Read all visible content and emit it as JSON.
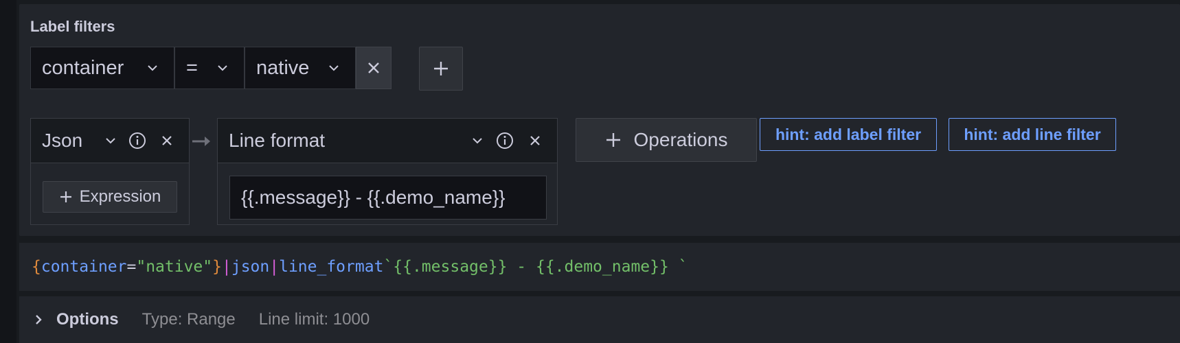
{
  "label_filters": {
    "title": "Label filters",
    "key": "container",
    "operator": "=",
    "value": "native"
  },
  "operations": [
    {
      "name": "Json",
      "add_expression_label": "Expression"
    },
    {
      "name": "Line format",
      "input_value": "{{.message}} - {{.demo_name}}"
    }
  ],
  "add_operations_label": "Operations",
  "hints": {
    "label_filter": "hint: add label filter",
    "line_filter": "hint: add line filter"
  },
  "query": {
    "open_brace": "{",
    "label": "container",
    "eq": "=",
    "value": "\"native\"",
    "close_brace": "}",
    "pipe1": "|",
    "json": "json",
    "pipe2": "|",
    "line_format_fn": "line_format",
    "template": "`{{.message}} - {{.demo_name}} `"
  },
  "options": {
    "title": "Options",
    "type": "Type: Range",
    "line_limit": "Line limit: 1000"
  },
  "colors": {
    "accent_blue": "#6e9fff",
    "string_green": "#73bf69",
    "brace_orange": "#e08a3c",
    "pipe_magenta": "#d75fd9"
  }
}
